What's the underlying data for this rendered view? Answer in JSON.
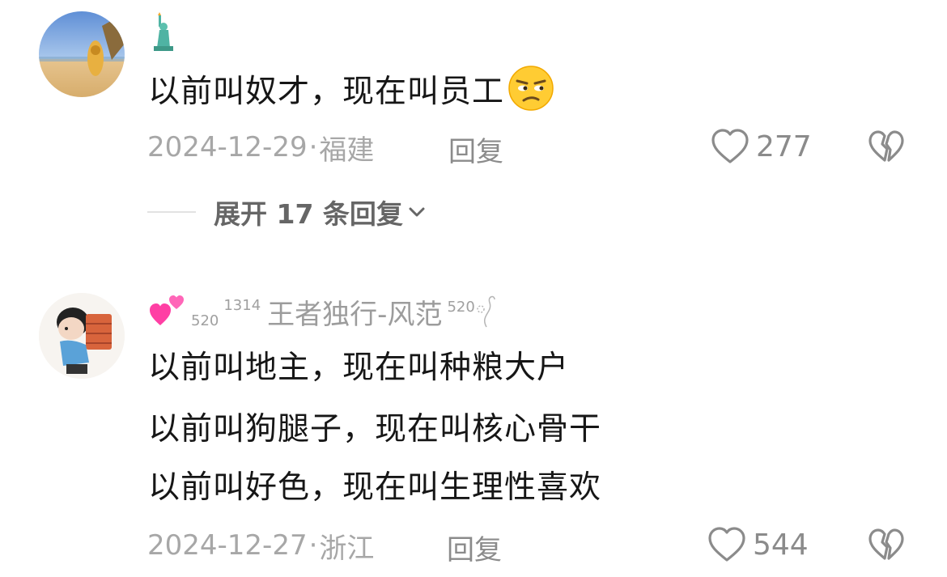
{
  "comments": [
    {
      "username": "",
      "badge_icon": "statue-of-liberty",
      "lines": [
        "以前叫奴才，现在叫员工"
      ],
      "trailing_emoji": "unamused-face",
      "date": "2024-12-29",
      "location": "福建",
      "reply_label": "回复",
      "like_count": "277",
      "expand_label": "展开 17 条回复"
    },
    {
      "username": "王者独行-风范",
      "name_prefix_520": "520",
      "name_prefix_1314": "1314",
      "name_suffix_520": "520",
      "badge_icon": "two-hearts",
      "lines": [
        "以前叫地主，现在叫种粮大户",
        "以前叫狗腿子，现在叫核心骨干",
        "以前叫好色，现在叫生理性喜欢"
      ],
      "date": "2024-12-27",
      "location": "浙江",
      "reply_label": "回复",
      "like_count": "544"
    }
  ],
  "meta_separator": "·",
  "colors": {
    "text_primary": "#161616",
    "text_meta": "#a7a7a7",
    "icon_gray": "#8b8b8b",
    "heart_pink": "#ff3fa4"
  }
}
